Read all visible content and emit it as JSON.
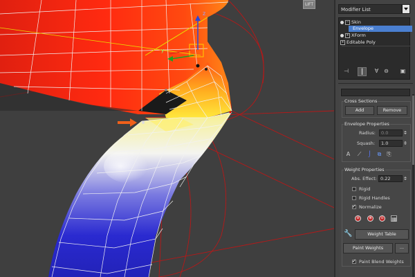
{
  "viewport": {
    "corner_label": "LIFT"
  },
  "modifier_panel": {
    "modifier_list_label": "Modifier List",
    "stack_items": [
      {
        "label": "Skin",
        "expanded": true
      },
      {
        "label": "Envelope",
        "selected": true
      },
      {
        "label": "XForm"
      },
      {
        "label": "Editable Poly"
      }
    ]
  },
  "cross_sections": {
    "title": "Cross Sections",
    "add_label": "Add",
    "remove_label": "Remove"
  },
  "envelope_properties": {
    "title": "Envelope Properties",
    "radius_label": "Radius:",
    "radius_value": "0.0",
    "squash_label": "Squash:",
    "squash_value": "1.0"
  },
  "weight_properties": {
    "title": "Weight Properties",
    "abs_effect_label": "Abs. Effect:",
    "abs_effect_value": "0.22",
    "rigid_label": "Rigid",
    "rigid_checked": false,
    "rigid_handles_label": "Rigid Handles",
    "rigid_handles_checked": false,
    "normalize_label": "Normalize",
    "normalize_checked": true,
    "weight_table_label": "Weight Table",
    "paint_weights_label": "Paint Weights",
    "paint_options_label": "...",
    "paint_blend_label": "Paint Blend Weights",
    "paint_blend_checked": true
  },
  "colors": {
    "selection": "#4a7fd0",
    "viewport_bg": "#3f3f3f",
    "panel_bg": "#444444",
    "gizmo_x": "#d62020",
    "gizmo_y": "#22a022",
    "gizmo_z": "#2b48d8",
    "arrow": "#f0601a"
  }
}
